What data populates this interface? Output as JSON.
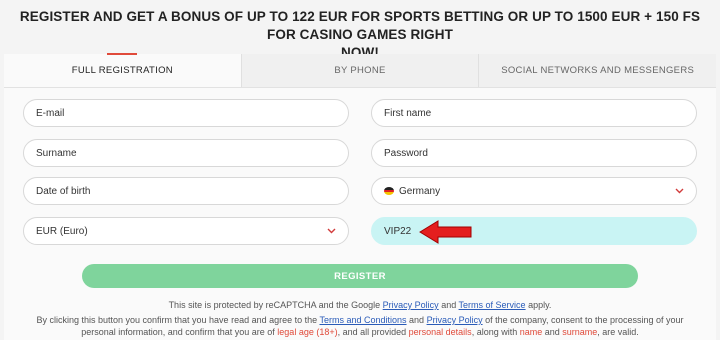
{
  "banner": {
    "line1": "REGISTER AND GET A BONUS OF UP TO 122 EUR FOR SPORTS BETTING OR UP TO 1500 EUR + 150 FS FOR CASINO GAMES RIGHT",
    "line2": "NOW!"
  },
  "tabs": [
    {
      "label": "FULL REGISTRATION",
      "active": true
    },
    {
      "label": "BY PHONE",
      "active": false
    },
    {
      "label": "SOCIAL NETWORKS AND MESSENGERS",
      "active": false
    }
  ],
  "form": {
    "email": "E-mail",
    "first_name": "First name",
    "surname": "Surname",
    "password": "Password",
    "date_of_birth": "Date of birth",
    "country": "Germany",
    "currency": "EUR (Euro)",
    "promo_code": "VIP22"
  },
  "register_label": "REGISTER",
  "recaptcha": {
    "before": "This site is protected by reCAPTCHA and the Google ",
    "privacy_link": "Privacy Policy",
    "and": " and ",
    "terms_link": "Terms of Service",
    "after": " apply."
  },
  "consent": {
    "p1": "By clicking this button you confirm that you have read and agree to the ",
    "terms_link": "Terms and Conditions",
    "p2": " and ",
    "privacy_link": "Privacy Policy",
    "p3": " of the company, consent to the processing of your personal information, and confirm that you are of ",
    "legal_age": "legal age (18+)",
    "p4": ", and all provided ",
    "personal_details": "personal details",
    "p5": ", along with ",
    "name": "name",
    "p6": " and ",
    "surname": "surname",
    "p7": ", are valid."
  },
  "colors": {
    "accent_red": "#e04a3a",
    "register_green": "#7fd49c",
    "promo_highlight": "#c9f4f4",
    "link_blue": "#2a5bb8"
  }
}
